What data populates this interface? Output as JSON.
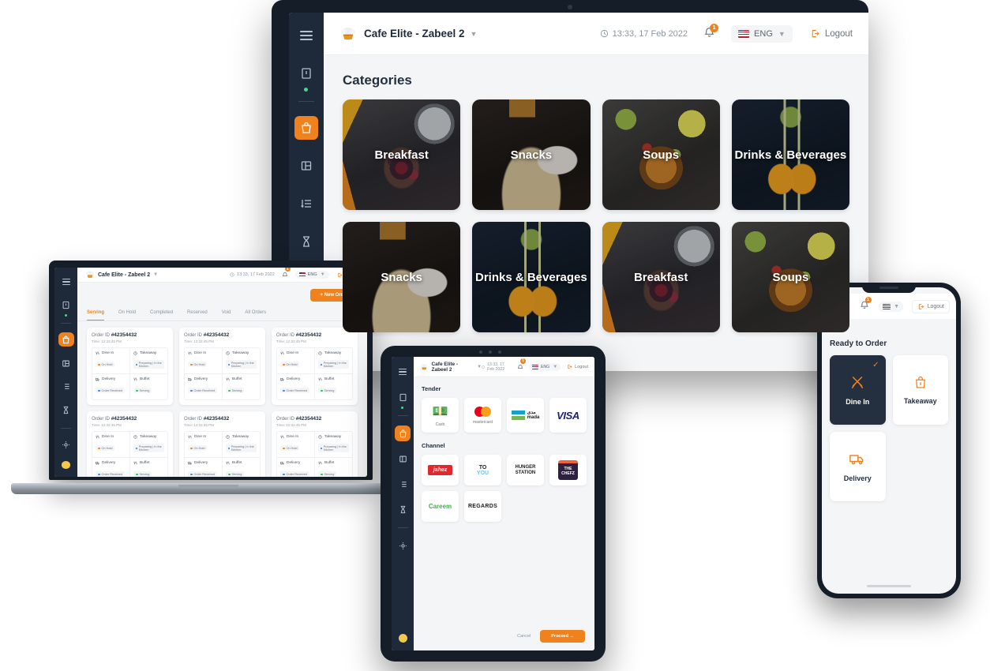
{
  "brand": {
    "name": "Cafe Elite - Zabeel 2",
    "logo_icon": "chef-hat-logo",
    "accent": "#f0821e",
    "dark": "#1e2a3a"
  },
  "header": {
    "datetime": "13:33, 17 Feb 2022",
    "clock_icon": "clock-icon",
    "bell_icon": "bell-icon",
    "notification_count": "1",
    "language": "ENG",
    "flag_icon": "us-flag-icon",
    "logout_label": "Logout",
    "logout_icon": "logout-icon",
    "chevron_icon": "chevron-down-icon"
  },
  "sidebar": {
    "items": [
      {
        "name": "menu-toggle",
        "icon": "hamburger-icon",
        "active": false
      },
      {
        "name": "store",
        "icon": "store-icon",
        "active": false,
        "status_dot": "#3ddc84"
      },
      {
        "name": "orders",
        "icon": "basket-icon",
        "active": true
      },
      {
        "name": "tables",
        "icon": "layout-icon",
        "active": false
      },
      {
        "name": "list",
        "icon": "list-icon",
        "active": false
      },
      {
        "name": "pending",
        "icon": "hourglass-icon",
        "active": false
      },
      {
        "name": "settings",
        "icon": "gear-icon",
        "active": false
      }
    ]
  },
  "desktop": {
    "section_title": "Categories",
    "categories": [
      {
        "label": "Breakfast",
        "art": "ph-breakfast"
      },
      {
        "label": "Snacks",
        "art": "ph-snacks"
      },
      {
        "label": "Soups",
        "art": "ph-soups"
      },
      {
        "label": "Drinks & Beverages",
        "art": "ph-drinks"
      },
      {
        "label": "Snacks",
        "art": "ph-snacks"
      },
      {
        "label": "Drinks & Beverages",
        "art": "ph-drinks"
      },
      {
        "label": "Breakfast",
        "art": "ph-breakfast"
      },
      {
        "label": "Soups",
        "art": "ph-soups"
      }
    ]
  },
  "laptop": {
    "new_order_label": "+ New Order",
    "tabs": [
      {
        "label": "Serving",
        "active": true
      },
      {
        "label": "On Hold",
        "active": false
      },
      {
        "label": "Completed",
        "active": false
      },
      {
        "label": "Reserved",
        "active": false
      },
      {
        "label": "Void",
        "active": false
      },
      {
        "label": "All Orders",
        "active": false
      }
    ],
    "order_id_label": "Order ID",
    "time_label": "Time:",
    "orders": [
      {
        "id": "#42354432",
        "time": "12:32:45 PM"
      },
      {
        "id": "#42354432",
        "time": "12:32:45 PM"
      },
      {
        "id": "#42354432",
        "time": "12:32:45 PM"
      },
      {
        "id": "#42354432",
        "time": "12:32:45 PM"
      },
      {
        "id": "#42354432",
        "time": "12:32:45 PM"
      },
      {
        "id": "#42354432",
        "time": "12:32:45 PM"
      }
    ],
    "order_cells": [
      {
        "title": "Dine In",
        "icon": "cutlery-icon",
        "badge": "On Hold",
        "badge_color": "orange"
      },
      {
        "title": "Takeaway",
        "icon": "takeaway-icon",
        "badge": "Preparing | In the Kitchen",
        "badge_color": "blue"
      },
      {
        "title": "Delivery",
        "icon": "delivery-icon",
        "badge": "Order Received",
        "badge_color": "blue"
      },
      {
        "title": "Buffet",
        "icon": "cutlery-icon",
        "badge": "Serving",
        "badge_color": "green"
      }
    ]
  },
  "tablet": {
    "tender_title": "Tender",
    "channel_title": "Channel",
    "tenders": [
      {
        "name": "cash",
        "label": "Cash",
        "logo": "cash-icon"
      },
      {
        "name": "mastercard",
        "label": "mastercard",
        "logo": "mastercard-logo"
      },
      {
        "name": "mada",
        "label": "",
        "logo": "mada-logo"
      },
      {
        "name": "visa",
        "label": "",
        "logo": "visa-logo"
      }
    ],
    "channels": [
      {
        "name": "jahez",
        "label": "jahez"
      },
      {
        "name": "toyou",
        "label": "TO YOU"
      },
      {
        "name": "hungerstation",
        "label": "HUNGER STATION"
      },
      {
        "name": "thechefz",
        "label": "THE CHEFZ"
      },
      {
        "name": "careem",
        "label": "Careem"
      },
      {
        "name": "regards",
        "label": "REGARDS"
      }
    ],
    "cancel_label": "Cancel",
    "proceed_label": "Proceed  →"
  },
  "phone": {
    "logout_label": "Logout",
    "menu_icon": "hamburger-icon",
    "title": "Ready to Order",
    "modes": [
      {
        "label": "Dine In",
        "icon": "cutlery-icon",
        "selected": true
      },
      {
        "label": "Takeaway",
        "icon": "bag-icon",
        "selected": false
      },
      {
        "label": "Delivery",
        "icon": "truck-icon",
        "selected": false
      }
    ]
  }
}
